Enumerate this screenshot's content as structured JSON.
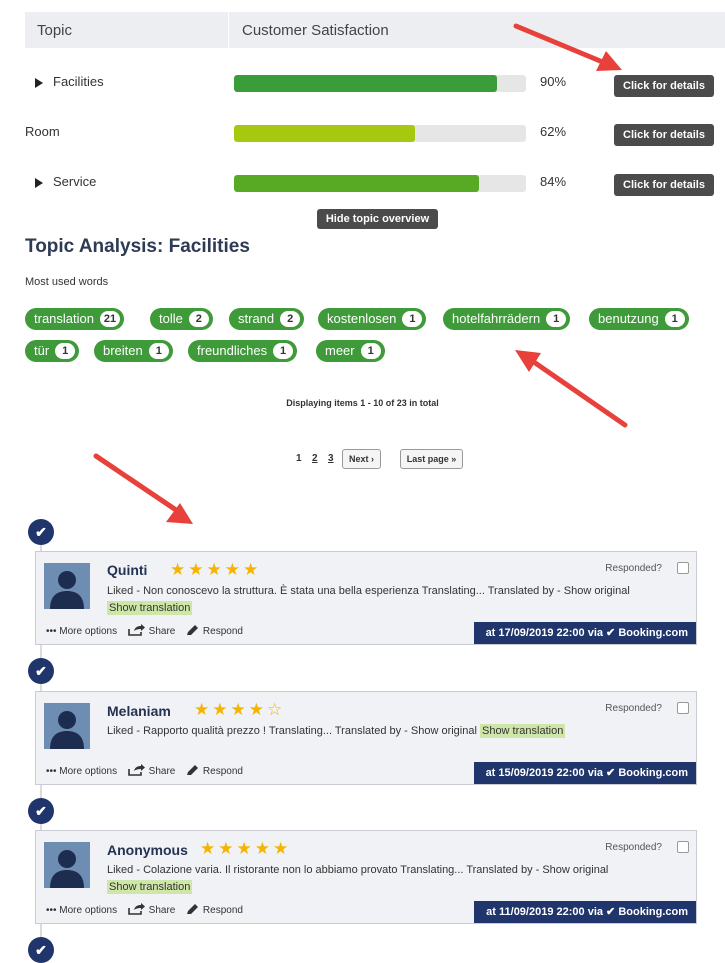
{
  "table": {
    "col_topic": "Topic",
    "col_satisfaction": "Customer Satisfaction",
    "rows": [
      {
        "label": "Facilities",
        "expandable": true,
        "percent_text": "90%",
        "value": 90,
        "color": "#3b9c3a",
        "button": "Click for details"
      },
      {
        "label": "Room",
        "expandable": false,
        "percent_text": "62%",
        "value": 62,
        "color": "#a6c90f",
        "button": "Click for details"
      },
      {
        "label": "Service",
        "expandable": true,
        "percent_text": "84%",
        "value": 84,
        "color": "#58a924",
        "button": "Click for details"
      }
    ],
    "hide_button": "Hide topic overview"
  },
  "analysis": {
    "title": "Topic Analysis: Facilities",
    "most_used_label": "Most used words",
    "tags": [
      {
        "word": "translation",
        "count": "21"
      },
      {
        "word": "tolle",
        "count": "2"
      },
      {
        "word": "strand",
        "count": "2"
      },
      {
        "word": "kostenlosen",
        "count": "1"
      },
      {
        "word": "hotelfahrrädern",
        "count": "1"
      },
      {
        "word": "benutzung",
        "count": "1"
      },
      {
        "word": "tür",
        "count": "1"
      },
      {
        "word": "breiten",
        "count": "1"
      },
      {
        "word": "freundliches",
        "count": "1"
      },
      {
        "word": "meer",
        "count": "1"
      }
    ]
  },
  "pagination": {
    "summary": "Displaying items 1 - 10 of 23 in total",
    "pages": [
      "1",
      "2",
      "3"
    ],
    "next": "Next ›",
    "last": "Last page »"
  },
  "reviews": [
    {
      "name": "Quinti",
      "stars": "★★★★★",
      "rating": 5,
      "responded_label": "Responded?",
      "text": "Liked  - Non conoscevo la struttura. È stata una bella esperienza Translating... Translated by - Show original",
      "show_translation": "Show translation",
      "more_options": "••• More options",
      "share": "Share",
      "respond": "Respond",
      "badge": "at 17/09/2019 22:00 via  ✔ Booking.com"
    },
    {
      "name": "Melaniam",
      "stars": "★★★★☆",
      "rating": 4,
      "responded_label": "Responded?",
      "text": "Liked  - Rapporto qualità prezzo ! Translating... Translated by - Show original",
      "show_translation": "Show translation",
      "more_options": "••• More options",
      "share": "Share",
      "respond": "Respond",
      "badge": "at 15/09/2019 22:00 via  ✔ Booking.com"
    },
    {
      "name": "Anonymous",
      "stars": "★★★★★",
      "rating": 5,
      "responded_label": "Responded?",
      "text": "Liked  - Colazione varia. Il ristorante non lo abbiamo provato Translating... Translated by - Show original",
      "show_translation": "Show translation",
      "more_options": "••• More options",
      "share": "Share",
      "respond": "Respond",
      "badge": "at 11/09/2019 22:00 via  ✔ Booking.com"
    }
  ],
  "colors": {
    "accent_navy": "#20356b",
    "tag_green": "#3f9b3a",
    "star": "#f4b400",
    "annotation_arrow": "#e8403a",
    "highlight": "#cfe6a9"
  },
  "icons": [
    "expand-triangle-icon",
    "checkmark-icon",
    "avatar-silhouette-icon",
    "share-icon",
    "pencil-icon",
    "annotation-arrow-icon"
  ]
}
